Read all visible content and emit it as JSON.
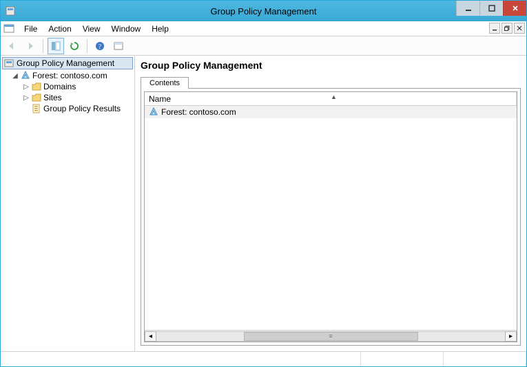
{
  "window": {
    "title": "Group Policy Management"
  },
  "menu": {
    "items": [
      "File",
      "Action",
      "View",
      "Window",
      "Help"
    ]
  },
  "toolbar": {
    "back": "back",
    "forward": "forward",
    "showhide": "showhide",
    "refresh": "refresh",
    "help": "help",
    "props": "props"
  },
  "tree": {
    "root": "Group Policy Management",
    "forest": "Forest: contoso.com",
    "children": [
      {
        "label": "Domains"
      },
      {
        "label": "Sites"
      },
      {
        "label": "Group Policy Results"
      }
    ]
  },
  "content": {
    "title": "Group Policy Management",
    "tab": "Contents",
    "column": "Name",
    "item": "Forest: contoso.com"
  }
}
